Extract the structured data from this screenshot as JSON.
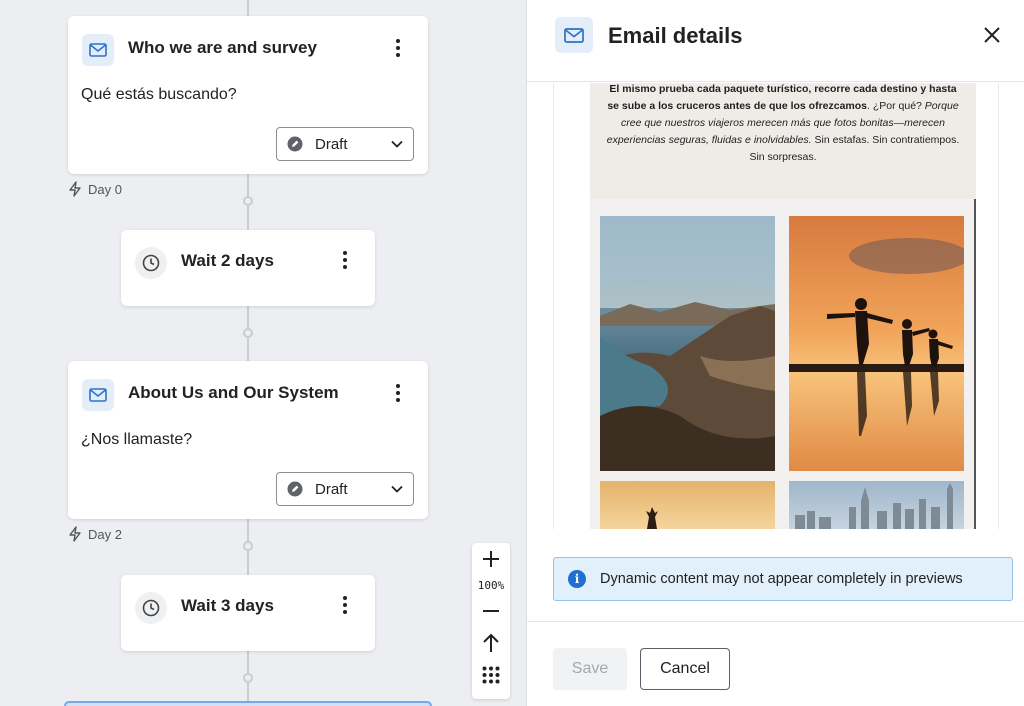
{
  "canvas": {
    "steps": [
      {
        "type": "email",
        "title": "Who we are and survey",
        "subject": "Qué estás buscando?",
        "status": "Draft",
        "day": "Day 0"
      },
      {
        "type": "wait",
        "title": "Wait 2 days"
      },
      {
        "type": "email",
        "title": "About Us and Our System",
        "subject": "¿Nos llamaste?",
        "status": "Draft",
        "day": "Day 2"
      },
      {
        "type": "wait",
        "title": "Wait 3 days"
      }
    ],
    "zoom": {
      "level": "100%"
    }
  },
  "panel": {
    "title": "Email details",
    "preview": {
      "line_bold": "El mismo prueba cada paquete turístico, recorre cada destino y hasta se sube a los cruceros antes de que los ofrezcamos",
      "line_q": ". ¿Por qué? ",
      "line_italic": "Porque cree que nuestros viajeros merecen más que fotos bonitas—merecen experiencias seguras, fluidas e inolvidables.",
      "line_end": " Sin estafas. Sin contratiempos. Sin sorpresas."
    },
    "info_banner": "Dynamic content may not appear completely in previews",
    "save_label": "Save",
    "cancel_label": "Cancel"
  },
  "colors": {
    "accent": "#1f6fd1",
    "mail_badge_bg": "#e4eef9",
    "info_bg": "#e2f0fc"
  },
  "icons": [
    "mail-icon",
    "kebab-menu-icon",
    "draft-status-icon",
    "chevron-down-icon",
    "bolt-icon",
    "clock-icon",
    "plus-icon",
    "minus-icon",
    "arrow-up-icon",
    "grid-icon",
    "close-icon",
    "info-icon"
  ]
}
